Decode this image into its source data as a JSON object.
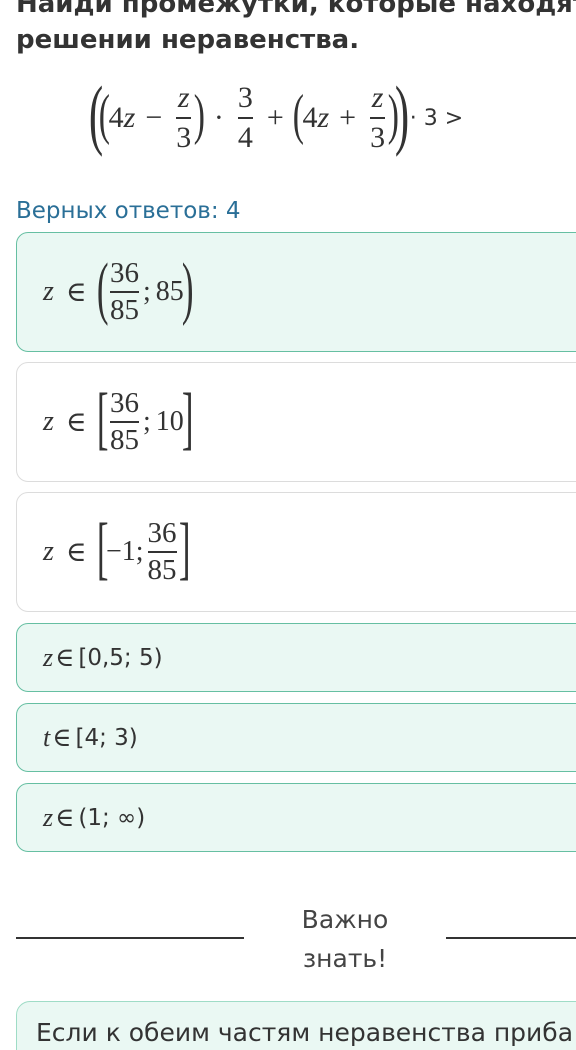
{
  "task": {
    "title_line1": "Найди промежутки, которые находятся",
    "title_line2": "решении неравенства.",
    "expression": {
      "open_outer": "(",
      "open_inner": "(",
      "coef_a": "4",
      "var": "z",
      "minus": "−",
      "frac1_num": "z",
      "frac1_den": "3",
      "close_inner": ")",
      "dot": "·",
      "frac2_num": "3",
      "frac2_den": "4",
      "plus": "+",
      "open_inner2": "(",
      "coef_b": "4",
      "plus2": "+",
      "frac3_num": "z",
      "frac3_den": "3",
      "close_inner2": ")",
      "close_outer": ")",
      "tail": "· 3 >"
    }
  },
  "counter": "Верных ответов: 4",
  "options": [
    {
      "var": "z",
      "in": "∈",
      "open": "(",
      "frac_num": "36",
      "frac_den": "85",
      "sep": ";",
      "right": "85",
      "close": ")",
      "selected": true
    },
    {
      "var": "z",
      "in": "∈",
      "open": "[",
      "frac_num": "36",
      "frac_den": "85",
      "sep": ";",
      "right": "10",
      "close": "]",
      "selected": false
    },
    {
      "var": "z",
      "in": "∈",
      "open": "[",
      "left": "−1;",
      "frac_num": "36",
      "frac_den": "85",
      "close": "]",
      "selected": false
    },
    {
      "var": "z",
      "in": "∈",
      "interval": "[0,5; 5)",
      "selected": true
    },
    {
      "var": "t",
      "in": "∈",
      "interval": "[4; 3)",
      "selected": true
    },
    {
      "var": "z",
      "in": "∈",
      "interval": "(1; ∞)",
      "selected": true
    }
  ],
  "important": "Важно знать!",
  "hint_text": "Если к обеим частям неравенства приба",
  "colors": {
    "accent_text": "#2a6f97",
    "selected_bg": "#eaf8f3",
    "selected_border": "#66bfa2",
    "border": "#dcdcdc"
  }
}
